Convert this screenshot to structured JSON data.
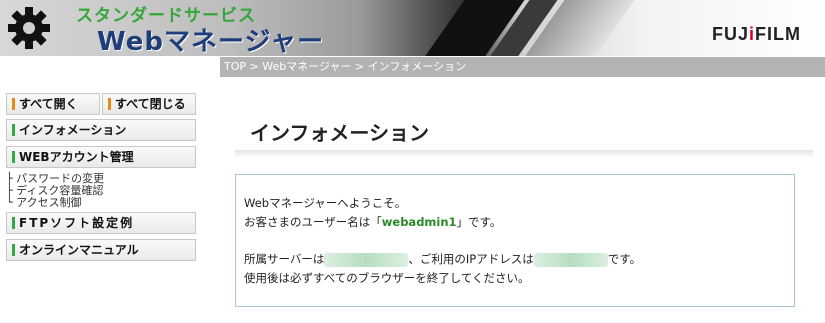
{
  "header": {
    "subtitle": "スタンダードサービス",
    "title": "Webマネージャー",
    "brand_a": "FUJ",
    "brand_dot": "i",
    "brand_b": "FILM"
  },
  "breadcrumb": {
    "items": [
      "TOP",
      "Webマネージャー",
      "インフォメーション"
    ],
    "separator": ">"
  },
  "sidebar": {
    "expand_all": "すべて開く",
    "collapse_all": "すべて閉じる",
    "items": [
      {
        "label": "インフォメーション"
      },
      {
        "label": "WEBアカウント管理"
      },
      {
        "label": "FTPソフト設定例"
      },
      {
        "label": "オンラインマニュアル"
      }
    ],
    "account_subitems": [
      "パスワードの変更",
      "ディスク容量確認",
      "アクセス制御"
    ]
  },
  "main": {
    "title": "インフォメーション",
    "welcome": "Webマネージャーへようこそ。",
    "user_prefix": "お客さまのユーザー名は「",
    "username": "webadmin1",
    "user_suffix": "」です。",
    "server_prefix": "所属サーバーは",
    "server_mid": "、ご利用のIPアドレスは",
    "server_suffix": "です。",
    "notice": "使用後は必ずすべてのブラウザーを終了してください。"
  },
  "colors": {
    "accent_green": "#35a84a",
    "accent_orange": "#e8891a",
    "title_blue": "#1f3d7a"
  }
}
